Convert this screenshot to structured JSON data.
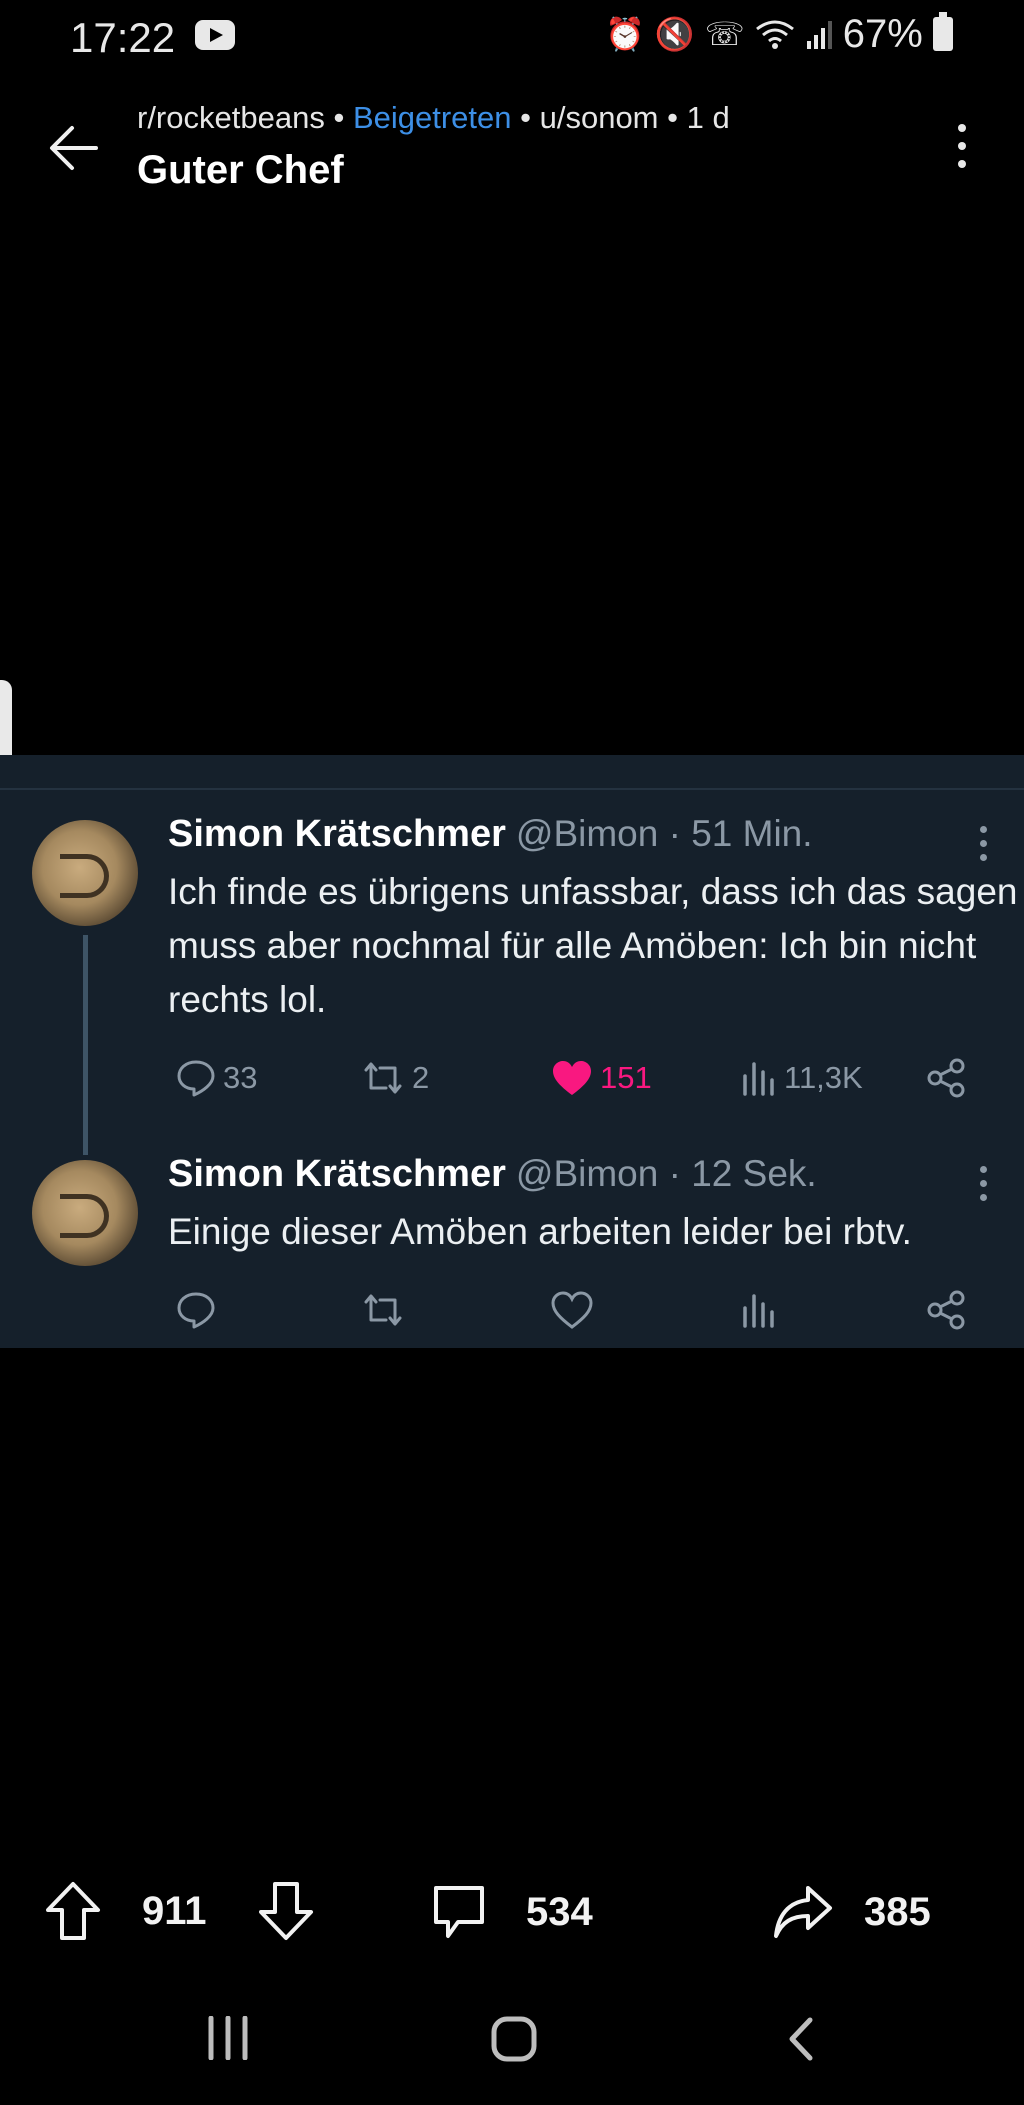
{
  "status_bar": {
    "time": "17:22",
    "battery": "67%"
  },
  "header": {
    "subreddit": "r/rocketbeans",
    "joined": "Beigetreten",
    "author": "u/sonom",
    "age": "1 d",
    "title": "Guter Chef",
    "sep": "•"
  },
  "tweets": [
    {
      "name": "Simon Krätschmer",
      "handle": "@Bimon · 51 Min.",
      "text": "Ich finde es übrigens unfassbar, dass ich das sagen muss aber nochmal für alle Amöben: Ich bin nicht rechts lol.",
      "replies": "33",
      "retweets": "2",
      "likes": "151",
      "views": "11,3K"
    },
    {
      "name": "Simon Krätschmer",
      "handle": "@Bimon · 12 Sek.",
      "text": "Einige dieser Amöben arbeiten leider bei rbtv."
    }
  ],
  "bottom_bar": {
    "upvotes": "911",
    "comments": "534",
    "shares": "385"
  },
  "colors": {
    "card_bg": "#15202b",
    "like": "#f91880",
    "joined": "#3d8fe6",
    "muted": "#8b98a5"
  }
}
